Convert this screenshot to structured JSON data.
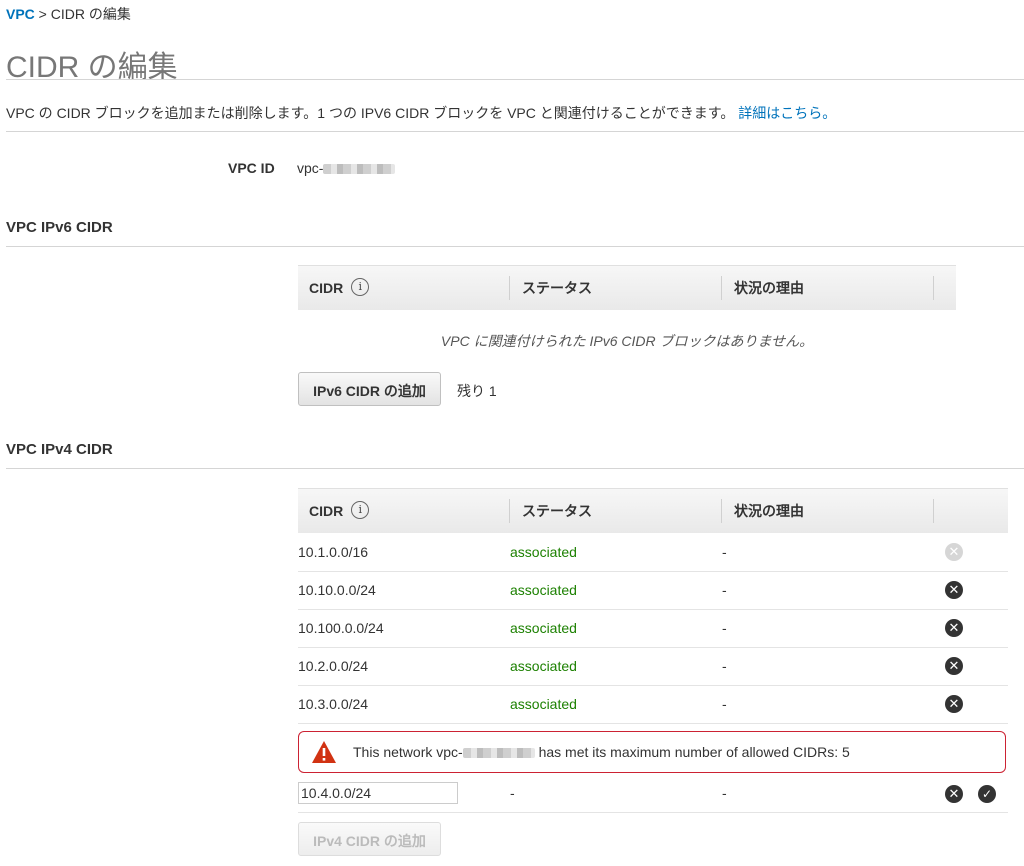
{
  "breadcrumb": {
    "root": "VPC",
    "separator": " > ",
    "current": "CIDR の編集"
  },
  "page": {
    "title": "CIDR の編集",
    "description": "VPC の CIDR ブロックを追加または削除します。1 つの IPV6 CIDR ブロックを VPC と関連付けることができます。",
    "learn_more": "詳細はこちら。"
  },
  "vpc": {
    "id_label": "VPC ID",
    "id_prefix": "vpc-"
  },
  "ipv6": {
    "section_title": "VPC IPv6 CIDR",
    "columns": [
      "CIDR",
      "ステータス",
      "状況の理由"
    ],
    "empty_message": "VPC に関連付けられた IPv6 CIDR ブロックはありません。",
    "add_button": "IPv6 CIDR の追加",
    "remaining": "残り 1"
  },
  "ipv4": {
    "section_title": "VPC IPv4 CIDR",
    "columns": [
      "CIDR",
      "ステータス",
      "状況の理由"
    ],
    "rows": [
      {
        "cidr": "10.1.0.0/16",
        "status": "associated",
        "reason": "-",
        "removable": false
      },
      {
        "cidr": "10.10.0.0/24",
        "status": "associated",
        "reason": "-",
        "removable": true
      },
      {
        "cidr": "10.100.0.0/24",
        "status": "associated",
        "reason": "-",
        "removable": true
      },
      {
        "cidr": "10.2.0.0/24",
        "status": "associated",
        "reason": "-",
        "removable": true
      },
      {
        "cidr": "10.3.0.0/24",
        "status": "associated",
        "reason": "-",
        "removable": true
      }
    ],
    "alert": {
      "text_before": "This network vpc-",
      "text_after": " has met its maximum number of allowed CIDRs: 5"
    },
    "new_row": {
      "input_value": "10.4.0.0/24",
      "status": "-",
      "reason": "-"
    },
    "add_button": "IPv4 CIDR の追加"
  },
  "icons": {
    "info": "info-icon",
    "remove": "remove-circle-icon",
    "confirm": "check-circle-icon",
    "warning": "warning-triangle-icon"
  },
  "colors": {
    "link": "#0073bb",
    "status_ok": "#1d8102",
    "alert_border": "#cc2233",
    "warning_red": "#d13212"
  }
}
